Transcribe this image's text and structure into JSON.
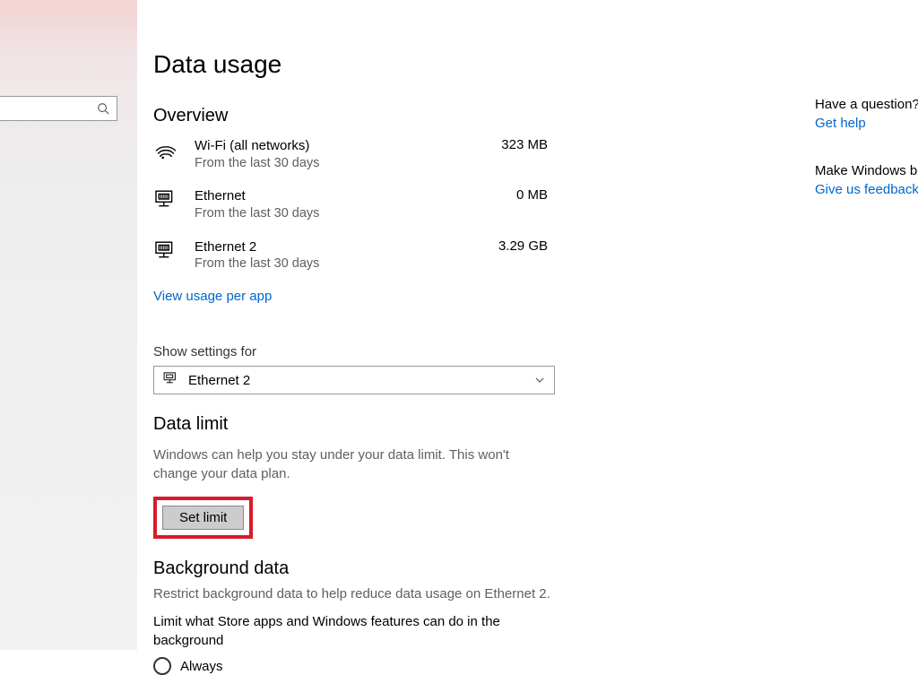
{
  "page": {
    "title": "Data usage"
  },
  "search": {
    "placeholder": ""
  },
  "overview": {
    "heading": "Overview",
    "items": [
      {
        "name": "Wi-Fi (all networks)",
        "sub": "From the last 30 days",
        "value": "323 MB",
        "icon": "wifi"
      },
      {
        "name": "Ethernet",
        "sub": "From the last 30 days",
        "value": "0 MB",
        "icon": "ethernet"
      },
      {
        "name": "Ethernet 2",
        "sub": "From the last 30 days",
        "value": "3.29 GB",
        "icon": "ethernet"
      }
    ],
    "viewPerApp": "View usage per app"
  },
  "settingsFor": {
    "label": "Show settings for",
    "selected": "Ethernet 2"
  },
  "dataLimit": {
    "heading": "Data limit",
    "description": "Windows can help you stay under your data limit. This won't change your data plan.",
    "button": "Set limit"
  },
  "backgroundData": {
    "heading": "Background data",
    "description": "Restrict background data to help reduce data usage on Ethernet 2.",
    "sub": "Limit what Store apps and Windows features can do in the background",
    "options": [
      {
        "label": "Always",
        "selected": false
      }
    ]
  },
  "rightPanel": {
    "questionHeading": "Have a question?",
    "helpLink": "Get help",
    "betterHeading": "Make Windows better",
    "feedbackLink": "Give us feedback"
  }
}
